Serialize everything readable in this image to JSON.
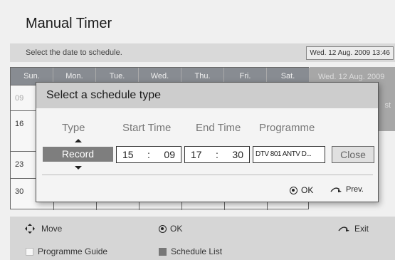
{
  "screen": {
    "title": "Manual Timer",
    "instruction": "Select the date to schedule.",
    "current_date": "Wed. 12 Aug. 2009 13:46"
  },
  "calendar": {
    "weekdays": [
      "Sun.",
      "Mon.",
      "Tue.",
      "Wed.",
      "Thu.",
      "Fri.",
      "Sat."
    ],
    "row_starts": [
      "09",
      "16",
      "23",
      "30"
    ],
    "side_date": "Wed. 12 Aug. 2009",
    "side_note": "st"
  },
  "dialog": {
    "title": "Select a schedule type",
    "columns": {
      "type": "Type",
      "start_time": "Start Time",
      "end_time": "End Time",
      "programme": "Programme"
    },
    "type_value": "Record",
    "start_hour": "15",
    "start_min": "09",
    "end_hour": "17",
    "end_min": "30",
    "time_sep": ":",
    "programme_value": "DTV 801 ANTV D...",
    "close_label": "Close",
    "ok_label": "OK",
    "prev_label": "Prev."
  },
  "footer": {
    "move_label": "Move",
    "ok_label": "OK",
    "exit_label": "Exit",
    "guide_label": "Programme Guide",
    "schedule_label": "Schedule List"
  }
}
